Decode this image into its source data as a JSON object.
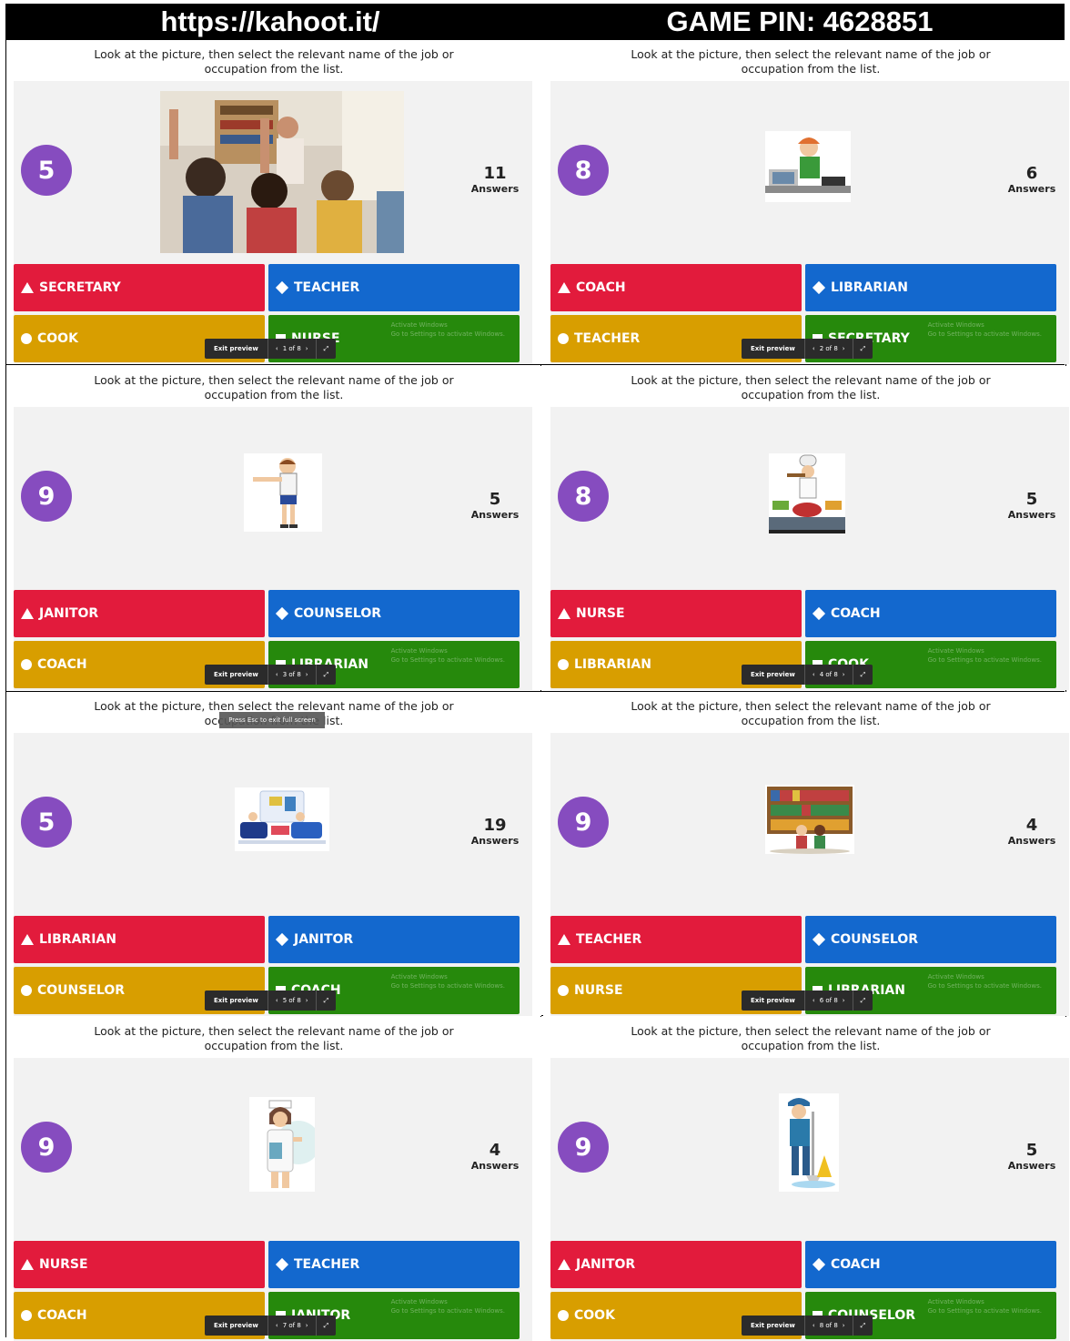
{
  "header": {
    "url": "https://kahoot.it/",
    "game_pin": "GAME PIN: 4628851"
  },
  "question_text": "Look at the picture, then select the relevant name of the job or occupation from the list.",
  "answers_label": "Answers",
  "exit_label": "Exit preview",
  "watermark": {
    "line1": "Activate Windows",
    "line2": "Go to Settings to activate Windows."
  },
  "esc_tip": "Press Esc to exit full screen",
  "colors": {
    "red": "#e21b3c",
    "blue": "#1368ce",
    "gold": "#d89e00",
    "green": "#26890c",
    "timer": "#864cbf"
  },
  "slides": [
    {
      "timer": "5",
      "answers": "11",
      "page": "1 of 8",
      "image": "classroom-photo",
      "options": [
        "SECRETARY",
        "TEACHER",
        "COOK",
        "NURSE"
      ]
    },
    {
      "timer": "8",
      "answers": "6",
      "page": "2 of 8",
      "image": "secretary-illustration",
      "options": [
        "COACH",
        "LIBRARIAN",
        "TEACHER",
        "SECRETARY"
      ]
    },
    {
      "timer": "9",
      "answers": "5",
      "page": "3 of 8",
      "image": "coach-illustration",
      "options": [
        "JANITOR",
        "COUNSELOR",
        "COACH",
        "LIBRARIAN"
      ]
    },
    {
      "timer": "8",
      "answers": "5",
      "page": "4 of 8",
      "image": "cook-illustration",
      "options": [
        "NURSE",
        "COACH",
        "LIBRARIAN",
        "COOK"
      ]
    },
    {
      "timer": "5",
      "answers": "19",
      "page": "5 of 8",
      "image": "counselor-illustration",
      "options": [
        "LIBRARIAN",
        "JANITOR",
        "COUNSELOR",
        "COACH"
      ]
    },
    {
      "timer": "9",
      "answers": "4",
      "page": "6 of 8",
      "image": "librarian-illustration",
      "options": [
        "TEACHER",
        "COUNSELOR",
        "NURSE",
        "LIBRARIAN"
      ]
    },
    {
      "timer": "9",
      "answers": "4",
      "page": "7 of 8",
      "image": "nurse-illustration",
      "options": [
        "NURSE",
        "TEACHER",
        "COACH",
        "JANITOR"
      ]
    },
    {
      "timer": "9",
      "answers": "5",
      "page": "8 of 8",
      "image": "janitor-illustration",
      "options": [
        "JANITOR",
        "COACH",
        "COOK",
        "COUNSELOR"
      ]
    }
  ]
}
